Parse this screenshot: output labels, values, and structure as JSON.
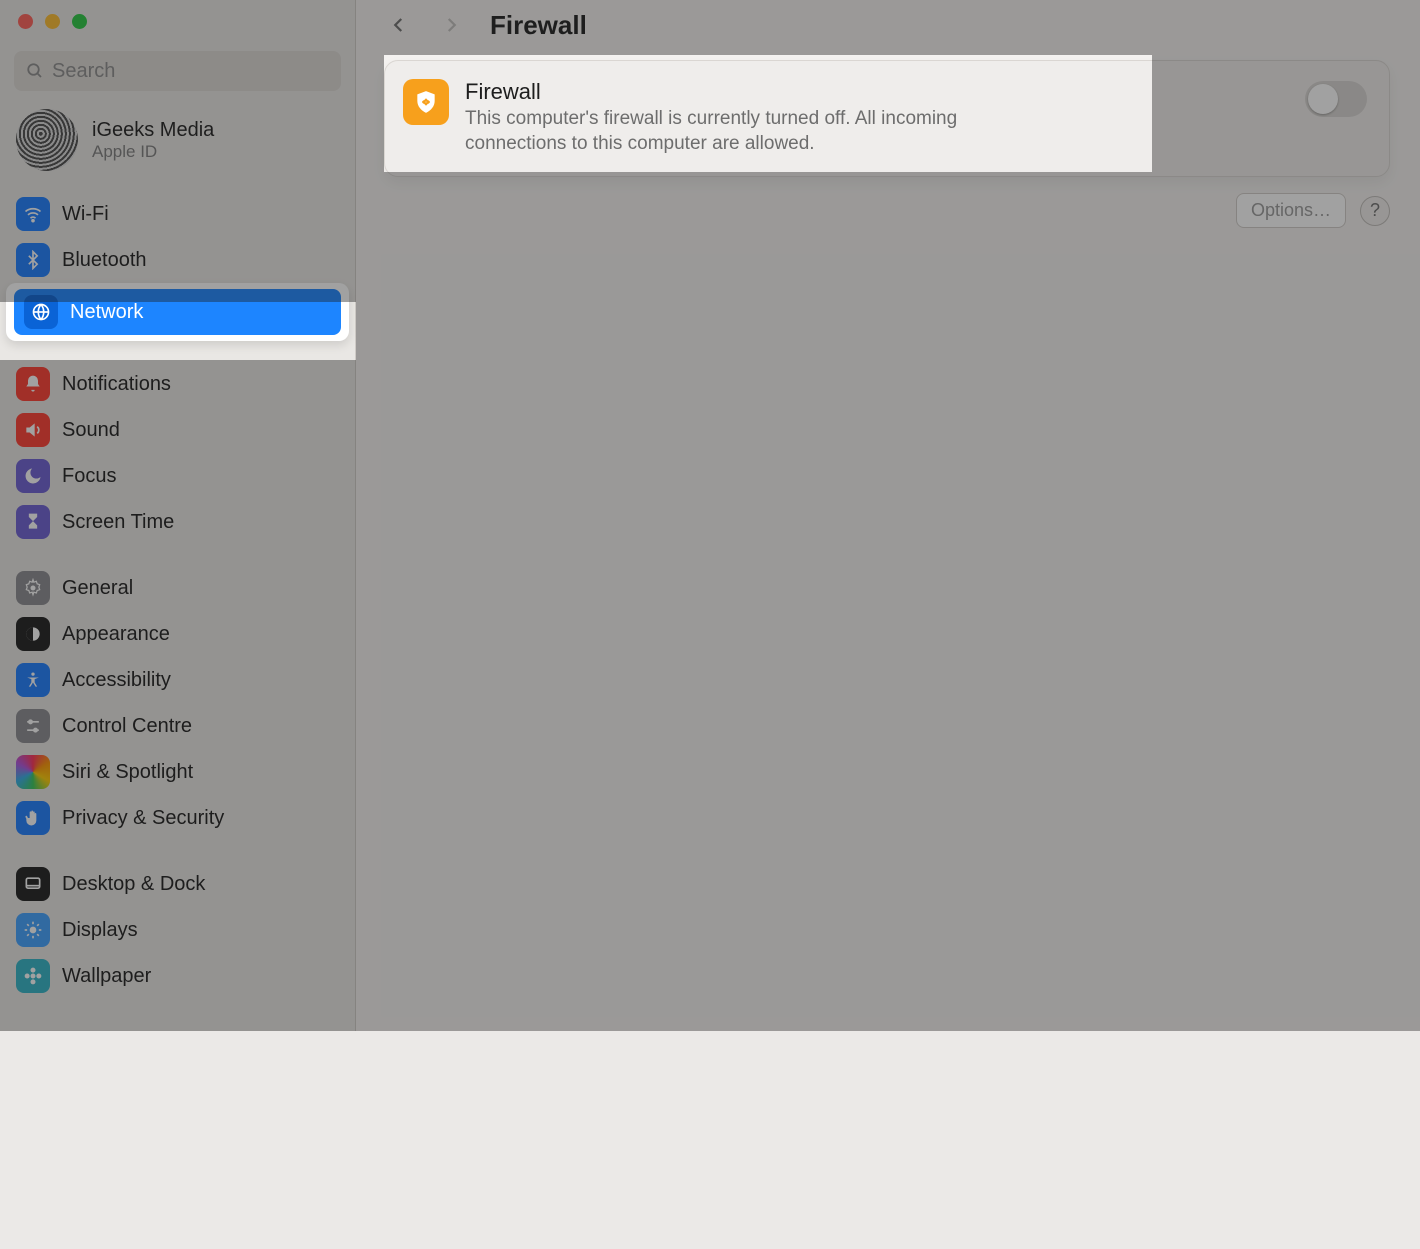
{
  "sidebar": {
    "search_placeholder": "Search",
    "account": {
      "name": "iGeeks Media",
      "sub": "Apple ID"
    },
    "items": {
      "wifi": "Wi-Fi",
      "bluetooth": "Bluetooth",
      "network": "Network",
      "notifications": "Notifications",
      "sound": "Sound",
      "focus": "Focus",
      "screen_time": "Screen Time",
      "general": "General",
      "appearance": "Appearance",
      "accessibility": "Accessibility",
      "control_centre": "Control Centre",
      "siri": "Siri & Spotlight",
      "privacy": "Privacy & Security",
      "desktop_dock": "Desktop & Dock",
      "displays": "Displays",
      "wallpaper": "Wallpaper"
    }
  },
  "header": {
    "title": "Firewall"
  },
  "firewall_card": {
    "title": "Firewall",
    "description": "This computer's firewall is currently turned off. All incoming connections to this computer are allowed.",
    "state": "off"
  },
  "buttons": {
    "options": "Options…",
    "help": "?"
  }
}
